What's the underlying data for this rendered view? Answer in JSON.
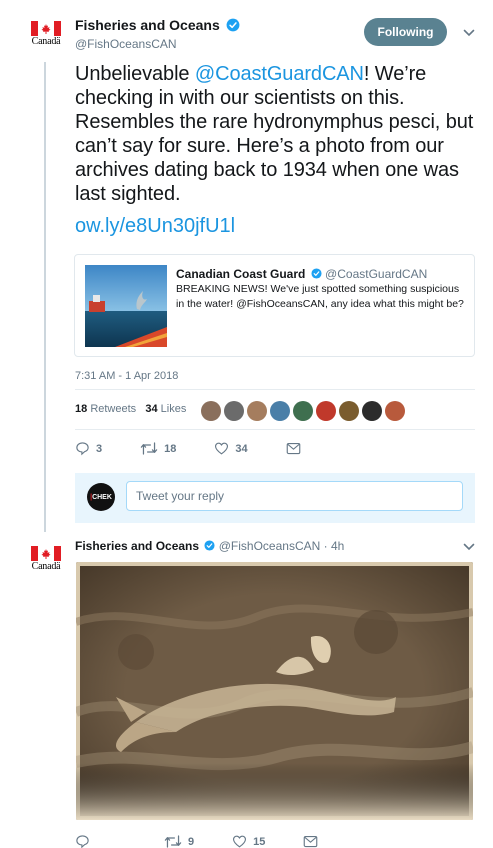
{
  "tweet": {
    "author_name": "Fisheries and Oceans",
    "author_handle": "@FishOceansCAN",
    "logo_wordmark": "Canadä",
    "follow_label": "Following",
    "text_before": "Unbelievable ",
    "mention": "@CoastGuardCAN",
    "text_after": "! We’re checking in with our scientists on this. Resembles the rare hydronymphus pesci, but can’t say for sure. Here’s a photo from our archives dating back to 1934 when one was last sighted.",
    "link": "ow.ly/e8Un30jfU1l",
    "quote": {
      "name": "Canadian Coast Guard",
      "handle": "@CoastGuardCAN",
      "text": "BREAKING NEWS! We've just spotted something suspicious in the water! @FishOceansCAN, any idea what this might be?"
    },
    "timestamp": "7:31 AM - 1 Apr 2018",
    "retweets_count": "18",
    "retweets_label": "Retweets",
    "likes_count": "34",
    "likes_label": "Likes",
    "actions": {
      "replies": "3",
      "retweets": "18",
      "likes": "34"
    },
    "liker_avatar_colors": [
      "#8a6f5c",
      "#6b6b6b",
      "#a57d5e",
      "#4a7fa8",
      "#3f6f4f",
      "#c0392b",
      "#7a5c2e",
      "#2c2c2c",
      "#b85a3c"
    ]
  },
  "reply": {
    "avatar_text": "CHEK",
    "placeholder": "Tweet your reply"
  },
  "reply_tweet": {
    "author_name": "Fisheries and Oceans",
    "author_handle": "@FishOceansCAN",
    "time_ago": "4h",
    "logo_wordmark": "Canadä",
    "actions": {
      "replies": "",
      "retweets": "9",
      "likes": "15"
    }
  },
  "colors": {
    "accent": "#1b95e0",
    "follow_button": "#5a8291",
    "flag_red": "#e11d24",
    "verified": "#1da1f2"
  }
}
